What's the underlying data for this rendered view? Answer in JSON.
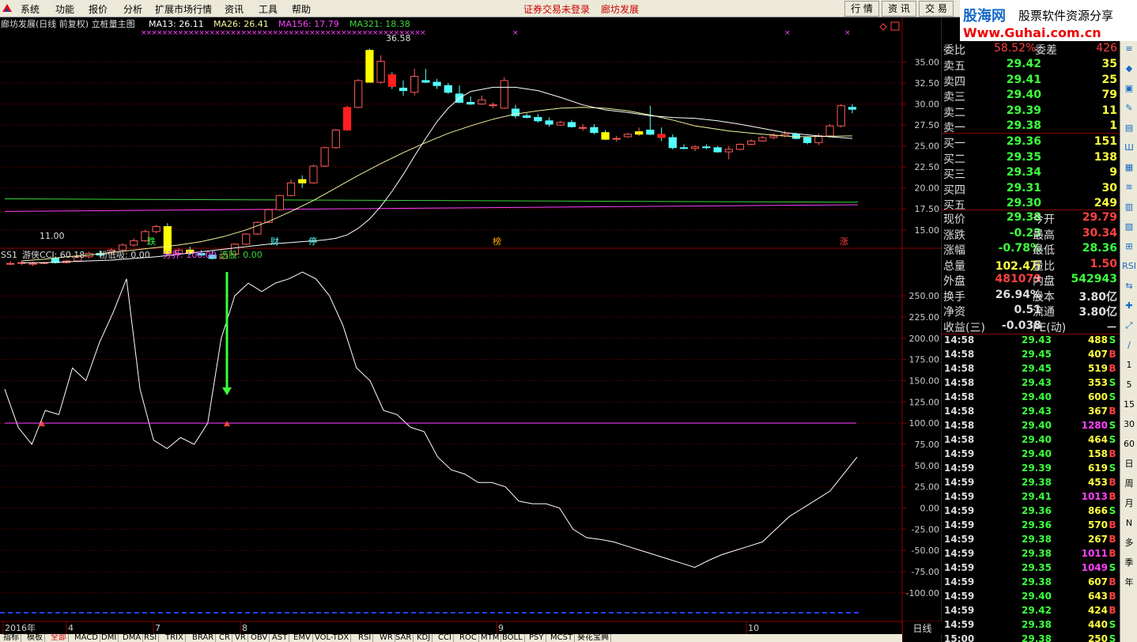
{
  "menu": {
    "items": [
      "系统",
      "功能",
      "报价",
      "分析",
      "扩展市场行情",
      "资讯",
      "工具",
      "帮助"
    ],
    "alert": "证券交易未登录",
    "stock": "廊坊发展"
  },
  "right_buttons": [
    "行 情",
    "资 讯",
    "交 易"
  ],
  "brand": {
    "name": "股海网",
    "tagline": "股票软件资源分享",
    "url": "Www.Guhai.com.cn"
  },
  "main_chart": {
    "title": "廊坊发展(日线 前复权) 立桩量主图",
    "ma13": "MA13: 26.11",
    "ma26": "MA26: 26.41",
    "ma156": "MA156: 17.79",
    "ma321": "MA321: 18.38",
    "high_label": "36.58",
    "low_label": "11.00",
    "markers": [
      "跌",
      "财",
      "停",
      "榜",
      "涨"
    ],
    "colors": {
      "up": "#ff5a5a",
      "down": "#54ffff",
      "ma13": "#ffffff",
      "ma26": "#f5f39a",
      "ma156": "#3cd63c",
      "ma321": "#ff40ff",
      "pos": "#ffff00",
      "grid": "#8a0000"
    }
  },
  "indicator": {
    "name": "SS1",
    "cci": "游侠CCI: 60.18",
    "xi": "粉低吸: 0.00",
    "fenjie": "分界: 100.00",
    "xuangu": "选股: 0.00"
  },
  "chart_data": [
    {
      "type": "candlestick",
      "title": "廊坊发展(日线 前复权) 立桩量主图",
      "y_ticks": [
        15.0,
        17.5,
        20.0,
        22.5,
        25.0,
        27.5,
        30.0,
        32.5,
        35.0
      ],
      "ylim": [
        13.0,
        37.5
      ],
      "x_labels": [
        "2016年",
        "4",
        "7",
        "8",
        "9",
        "10"
      ],
      "candles": [
        [
          11.0,
          11.3,
          10.8,
          11.0
        ],
        [
          11.0,
          11.3,
          10.8,
          11.1
        ],
        [
          10.9,
          11.2,
          10.7,
          11.0
        ],
        [
          11.0,
          11.2,
          10.9,
          11.1
        ],
        [
          11.6,
          11.8,
          11.0,
          11.1
        ],
        [
          11.1,
          11.4,
          11.0,
          11.3
        ],
        [
          11.3,
          12.0,
          11.2,
          11.8
        ],
        [
          11.8,
          12.4,
          11.6,
          12.2
        ],
        [
          12.2,
          12.5,
          11.9,
          12.0
        ],
        [
          12.3,
          12.8,
          12.1,
          12.6
        ],
        [
          12.6,
          13.4,
          12.5,
          13.2
        ],
        [
          13.2,
          14.0,
          13.0,
          13.7
        ],
        [
          13.7,
          15.0,
          13.6,
          14.8
        ],
        [
          14.8,
          15.6,
          14.6,
          15.4
        ],
        [
          15.4,
          15.8,
          12.0,
          12.2
        ],
        [
          12.2,
          12.8,
          12.0,
          12.6
        ],
        [
          12.6,
          13.0,
          12.0,
          12.2
        ],
        [
          12.2,
          12.6,
          11.8,
          12.0
        ],
        [
          12.0,
          12.5,
          11.5,
          11.6
        ],
        [
          11.6,
          12.3,
          11.5,
          12.1
        ],
        [
          12.1,
          13.4,
          11.9,
          13.3
        ],
        [
          13.3,
          14.6,
          13.2,
          14.5
        ],
        [
          14.5,
          16.0,
          14.4,
          15.9
        ],
        [
          15.9,
          17.5,
          15.8,
          17.4
        ],
        [
          17.4,
          19.2,
          17.3,
          19.1
        ],
        [
          19.1,
          21.0,
          19.0,
          20.6
        ],
        [
          21.0,
          21.5,
          20.0,
          20.6
        ],
        [
          20.6,
          22.8,
          20.5,
          22.6
        ],
        [
          22.6,
          24.9,
          22.5,
          24.8
        ],
        [
          24.8,
          27.0,
          24.7,
          26.9
        ],
        [
          26.9,
          29.8,
          26.8,
          29.6
        ],
        [
          29.6,
          33.0,
          29.5,
          32.8
        ],
        [
          36.4,
          36.6,
          32.6,
          32.6
        ],
        [
          32.6,
          35.8,
          32.4,
          35.1
        ],
        [
          33.5,
          33.8,
          31.8,
          32.1
        ],
        [
          31.9,
          32.8,
          31.0,
          31.6
        ],
        [
          31.4,
          34.2,
          31.0,
          33.3
        ],
        [
          32.8,
          34.2,
          32.5,
          32.6
        ],
        [
          32.6,
          33.0,
          31.8,
          32.2
        ],
        [
          32.2,
          32.5,
          31.2,
          31.4
        ],
        [
          31.2,
          32.2,
          30.1,
          30.2
        ],
        [
          30.2,
          30.9,
          29.9,
          30.0
        ],
        [
          30.0,
          31.0,
          29.9,
          30.5
        ],
        [
          29.8,
          30.2,
          29.5,
          29.9
        ],
        [
          29.5,
          33.2,
          29.4,
          32.8
        ],
        [
          29.4,
          29.9,
          28.3,
          28.6
        ],
        [
          28.6,
          28.9,
          28.3,
          28.4
        ],
        [
          28.4,
          28.8,
          27.8,
          28.0
        ],
        [
          28.0,
          28.4,
          27.3,
          27.6
        ],
        [
          27.5,
          28.0,
          27.4,
          27.8
        ],
        [
          27.8,
          28.1,
          27.2,
          27.3
        ],
        [
          27.2,
          27.6,
          26.8,
          27.2
        ],
        [
          27.2,
          27.6,
          26.4,
          26.6
        ],
        [
          26.6,
          26.9,
          25.7,
          25.8
        ],
        [
          25.9,
          26.2,
          25.5,
          25.9
        ],
        [
          26.1,
          26.6,
          26.0,
          26.4
        ],
        [
          26.4,
          27.2,
          26.2,
          26.7
        ],
        [
          26.9,
          29.8,
          26.3,
          26.4
        ],
        [
          26.4,
          27.2,
          25.6,
          26.0
        ],
        [
          26.0,
          26.4,
          24.6,
          24.8
        ],
        [
          24.8,
          25.2,
          24.6,
          24.7
        ],
        [
          24.7,
          25.1,
          24.4,
          24.9
        ],
        [
          24.9,
          25.2,
          24.6,
          24.8
        ],
        [
          24.8,
          25.0,
          24.2,
          24.3
        ],
        [
          24.3,
          25.0,
          23.4,
          24.6
        ],
        [
          24.6,
          25.3,
          24.5,
          25.2
        ],
        [
          25.2,
          25.8,
          25.1,
          25.6
        ],
        [
          25.6,
          26.2,
          25.5,
          26.0
        ],
        [
          26.0,
          26.5,
          25.8,
          26.2
        ],
        [
          26.2,
          26.8,
          26.0,
          26.4
        ],
        [
          26.4,
          26.6,
          25.8,
          25.9
        ],
        [
          26.0,
          26.1,
          25.2,
          25.4
        ],
        [
          25.4,
          26.5,
          25.1,
          26.2
        ],
        [
          26.2,
          27.6,
          26.0,
          27.4
        ],
        [
          27.4,
          30.0,
          27.2,
          29.8
        ],
        [
          29.6,
          30.0,
          28.9,
          29.38
        ]
      ],
      "ma13": [
        11.1,
        11.1,
        11.2,
        11.3,
        11.4,
        11.6,
        11.8,
        12.1,
        12.4,
        12.7,
        13.0,
        13.3,
        13.5,
        13.6,
        13.7,
        13.8,
        14.0,
        14.4,
        15.2,
        16.3,
        17.8,
        19.6,
        21.6,
        23.8,
        25.9,
        27.9,
        29.5,
        30.7,
        31.5,
        32.0,
        32.0,
        31.6,
        30.8,
        29.9,
        29.3,
        29.0,
        28.6,
        28.4,
        28.3,
        28.0,
        27.6,
        27.1,
        26.6,
        26.2,
        25.9
      ],
      "ma13_x": [
        1,
        3,
        5,
        7,
        9,
        11,
        13,
        15,
        17,
        19,
        21,
        23,
        25,
        26,
        27,
        28,
        29,
        30,
        31,
        32,
        33,
        34,
        35,
        36,
        37,
        38,
        39,
        40,
        41,
        43,
        45,
        47,
        49,
        51,
        53,
        55,
        57,
        59,
        61,
        63,
        65,
        67,
        69,
        72,
        75
      ],
      "ma26": [
        11.3,
        11.5,
        11.8,
        12.0,
        12.3,
        12.6,
        12.9,
        13.2,
        13.6,
        14.2,
        15.0,
        16.0,
        17.2,
        18.5,
        20.0,
        21.5,
        22.9,
        24.2,
        25.4,
        26.5,
        27.4,
        28.2,
        28.8,
        29.2,
        29.5,
        29.6,
        29.5,
        29.2,
        28.7,
        28.1,
        27.4,
        26.8,
        26.4,
        26.1,
        26.2
      ],
      "ma26_x": [
        1,
        3,
        5,
        7,
        9,
        11,
        13,
        15,
        17,
        19,
        21,
        23,
        25,
        27,
        29,
        31,
        33,
        35,
        37,
        39,
        41,
        43,
        45,
        47,
        49,
        51,
        53,
        55,
        57,
        59,
        61,
        64,
        67,
        70,
        75
      ],
      "ma156": [
        18.7,
        18.3
      ],
      "ma321": [
        17.2,
        18.0
      ]
    },
    {
      "type": "line",
      "title": "SS1 游侠CCI",
      "series_name": "游侠CCI",
      "y_ticks": [
        -100.0,
        -75.0,
        -50.0,
        -25.0,
        0.0,
        25.0,
        50.0,
        75.0,
        100.0,
        125.0,
        150.0,
        175.0,
        200.0,
        225.0,
        250.0
      ],
      "ylim": [
        -130,
        280
      ],
      "x_start": 0,
      "x_step": 1,
      "values": [
        140,
        95,
        75,
        115,
        110,
        165,
        150,
        195,
        230,
        270,
        140,
        80,
        70,
        83,
        75,
        100,
        200,
        250,
        265,
        255,
        265,
        270,
        278,
        270,
        250,
        215,
        165,
        150,
        115,
        110,
        95,
        90,
        60,
        45,
        40,
        30,
        30,
        25,
        8,
        5,
        5,
        0,
        -25,
        -35,
        -37,
        -40,
        -45,
        -50,
        -55,
        -60,
        -65,
        -70,
        -62,
        -55,
        -50,
        -45,
        -40,
        -25,
        -10,
        0,
        10,
        20,
        40,
        60
      ],
      "x_points": [
        0,
        1,
        2,
        3,
        4,
        5,
        6,
        7,
        8,
        9,
        10,
        11,
        12,
        13,
        14,
        15,
        16,
        17,
        18,
        19,
        20,
        21,
        22,
        23,
        24,
        25,
        26,
        27,
        28,
        29,
        30,
        31,
        32,
        33,
        34,
        35,
        36,
        37,
        38,
        39,
        40,
        41,
        42,
        43,
        44,
        45,
        46,
        47,
        48,
        49,
        50,
        51,
        52,
        53,
        54,
        55,
        56,
        57,
        58,
        59,
        60,
        61,
        62,
        63
      ],
      "fenjie": 100
    }
  ],
  "quote": {
    "weibi_label": "委比",
    "weibi": "58.52%",
    "weicha_label": "委差",
    "weicha": "426",
    "asks": [
      {
        "label": "卖五",
        "price": "29.42",
        "vol": "35"
      },
      {
        "label": "卖四",
        "price": "29.41",
        "vol": "25"
      },
      {
        "label": "卖三",
        "price": "29.40",
        "vol": "79"
      },
      {
        "label": "卖二",
        "price": "29.39",
        "vol": "11"
      },
      {
        "label": "卖一",
        "price": "29.38",
        "vol": "1"
      }
    ],
    "bids": [
      {
        "label": "买一",
        "price": "29.36",
        "vol": "151"
      },
      {
        "label": "买二",
        "price": "29.35",
        "vol": "138"
      },
      {
        "label": "买三",
        "price": "29.34",
        "vol": "9"
      },
      {
        "label": "买四",
        "price": "29.31",
        "vol": "30"
      },
      {
        "label": "买五",
        "price": "29.30",
        "vol": "249"
      }
    ],
    "stats": [
      {
        "l1": "现价",
        "v1": "29.38",
        "c1": "#3cff3c",
        "l2": "今开",
        "v2": "29.79",
        "c2": "#ff4040"
      },
      {
        "l1": "涨跌",
        "v1": "-0.23",
        "c1": "#3cff3c",
        "l2": "最高",
        "v2": "30.34",
        "c2": "#ff4040"
      },
      {
        "l1": "涨幅",
        "v1": "-0.78%",
        "c1": "#3cff3c",
        "l2": "最低",
        "v2": "28.36",
        "c2": "#3cff3c"
      },
      {
        "l1": "总量",
        "v1": "102.4万",
        "c1": "#ffff40",
        "l2": "量比",
        "v2": "1.50",
        "c2": "#ff4040"
      },
      {
        "l1": "外盘",
        "v1": "481079",
        "c1": "#ff4040",
        "l2": "内盘",
        "v2": "542943",
        "c2": "#3cff3c"
      },
      {
        "l1": "换手",
        "v1": "26.94%",
        "c1": "#dddddd",
        "l2": "股本",
        "v2": "3.80亿",
        "c2": "#dddddd"
      },
      {
        "l1": "净资",
        "v1": "0.51",
        "c1": "#dddddd",
        "l2": "流通",
        "v2": "3.80亿",
        "c2": "#dddddd"
      },
      {
        "l1": "收益(三)",
        "v1": "-0.038",
        "c1": "#dddddd",
        "l2": "PE(动)",
        "v2": "－",
        "c2": "#dddddd"
      }
    ]
  },
  "ticks": [
    {
      "t": "14:58",
      "p": "29.43",
      "v": "488",
      "d": "S"
    },
    {
      "t": "14:58",
      "p": "29.45",
      "v": "407",
      "d": "B"
    },
    {
      "t": "14:58",
      "p": "29.45",
      "v": "519",
      "d": "B"
    },
    {
      "t": "14:58",
      "p": "29.43",
      "v": "353",
      "d": "S"
    },
    {
      "t": "14:58",
      "p": "29.40",
      "v": "600",
      "d": "S"
    },
    {
      "t": "14:58",
      "p": "29.43",
      "v": "367",
      "d": "B"
    },
    {
      "t": "14:58",
      "p": "29.40",
      "v": "1280",
      "d": "S"
    },
    {
      "t": "14:58",
      "p": "29.40",
      "v": "464",
      "d": "S"
    },
    {
      "t": "14:59",
      "p": "29.40",
      "v": "158",
      "d": "B"
    },
    {
      "t": "14:59",
      "p": "29.39",
      "v": "619",
      "d": "S"
    },
    {
      "t": "14:59",
      "p": "29.38",
      "v": "453",
      "d": "B"
    },
    {
      "t": "14:59",
      "p": "29.41",
      "v": "1013",
      "d": "B"
    },
    {
      "t": "14:59",
      "p": "29.36",
      "v": "866",
      "d": "S"
    },
    {
      "t": "14:59",
      "p": "29.36",
      "v": "570",
      "d": "B"
    },
    {
      "t": "14:59",
      "p": "29.38",
      "v": "267",
      "d": "B"
    },
    {
      "t": "14:59",
      "p": "29.38",
      "v": "1011",
      "d": "B"
    },
    {
      "t": "14:59",
      "p": "29.35",
      "v": "1049",
      "d": "S"
    },
    {
      "t": "14:59",
      "p": "29.38",
      "v": "607",
      "d": "B"
    },
    {
      "t": "14:59",
      "p": "29.40",
      "v": "643",
      "d": "B"
    },
    {
      "t": "14:59",
      "p": "29.42",
      "v": "424",
      "d": "B"
    },
    {
      "t": "14:59",
      "p": "29.38",
      "v": "440",
      "d": "S"
    },
    {
      "t": "15:00",
      "p": "29.38",
      "v": "250",
      "d": "S"
    }
  ],
  "side_tools": [
    "≡",
    "◆",
    "▣",
    "✎",
    "▤",
    "Ш",
    "▦",
    "≋",
    "▥",
    "▧",
    "⊞",
    "RSI",
    "⇆",
    "✚",
    "⤢",
    "∕",
    "1",
    "5",
    "15",
    "30",
    "60",
    "日",
    "周",
    "月",
    "N",
    "多",
    "季",
    "年"
  ],
  "bottom_tabs": [
    "指标",
    "模板",
    "全部",
    "MACD",
    "DMI",
    "DMA",
    "RSI",
    "TRIX",
    "BRAR",
    "CR",
    "VR",
    "OBV",
    "AST",
    "EMV",
    "VOL-TDX",
    "RSI",
    "WR",
    "SAR",
    "KDJ",
    "CCI",
    "ROC",
    "MTM",
    "BOLL",
    "PSY",
    "MCST",
    "葵花宝典"
  ],
  "period": "日线"
}
